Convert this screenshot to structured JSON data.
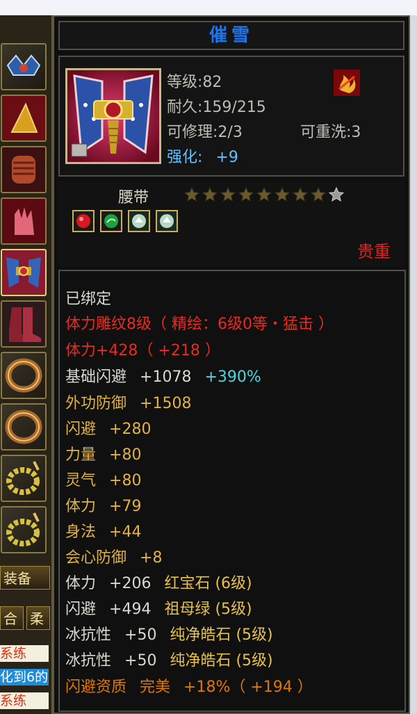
{
  "title": "催雪",
  "info": {
    "level": "等级:82",
    "durability": "耐久:159/215",
    "repairable": "可修理:2/3",
    "rewashable": "可重洗:3",
    "enhance_label": "强化:",
    "enhance_value": "+9"
  },
  "item_type": "腰带",
  "stars": {
    "filled": 8,
    "total": 9
  },
  "rarity": "贵重",
  "bound": "已绑定",
  "engrave": "体力雕纹8级（ 精绘：6级0等・猛击 ）",
  "stamina_total": {
    "label": "体力+428",
    "bonus": "（ +218 ）"
  },
  "stats": [
    {
      "name": "基础闪避",
      "value": "+1078",
      "extra": "+390%"
    },
    {
      "name": "外功防御",
      "value": "+1508"
    },
    {
      "name": "闪避",
      "value": "+280"
    },
    {
      "name": "力量",
      "value": "+80"
    },
    {
      "name": "灵气",
      "value": "+80"
    },
    {
      "name": "体力",
      "value": "+79"
    },
    {
      "name": "身法",
      "value": "+44"
    },
    {
      "name": "会心防御",
      "value": "+8"
    }
  ],
  "gem_stats": [
    {
      "name": "体力",
      "value": "+206",
      "gem": "红宝石 (6级)"
    },
    {
      "name": "闪避",
      "value": "+494",
      "gem": "祖母绿 (5级)"
    },
    {
      "name": "冰抗性",
      "value": "+50",
      "gem": "纯净皓石 (5级)"
    },
    {
      "name": "冰抗性",
      "value": "+50",
      "gem": "纯净皓石 (5级)"
    }
  ],
  "aptitude": {
    "name": "闪避资质",
    "grade": "完美",
    "value": "+18%",
    "bonus": "（ +194 ）"
  },
  "sidebar": {
    "equip_label": "装备",
    "btn_a": "合",
    "btn_b": "柔",
    "frag1": "系练",
    "frag2": "化到6的",
    "frag3": "系练"
  },
  "colors": {
    "title": "#1e74e8",
    "enhance": "#5fc4ff",
    "rarity": "#e42020",
    "engrave": "#ea2a20",
    "stat": "#e2b33e",
    "gem_name": "#e7c247",
    "aptitude": "#e07800"
  }
}
